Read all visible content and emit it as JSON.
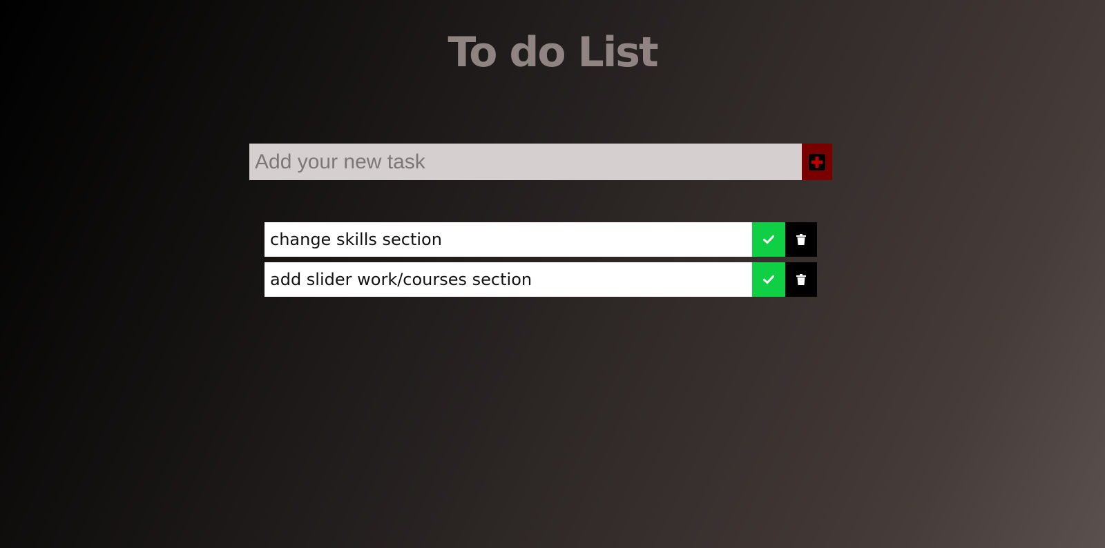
{
  "app": {
    "title": "To do List"
  },
  "new_task": {
    "placeholder": "Add your new task",
    "value": "",
    "add_icon": "plus-square-icon"
  },
  "tasks": [
    {
      "text": "change skills section",
      "complete_icon": "check-icon",
      "delete_icon": "trash-icon"
    },
    {
      "text": "add slider work/courses section",
      "complete_icon": "check-icon",
      "delete_icon": "trash-icon"
    }
  ],
  "colors": {
    "add_button": "#7a0000",
    "add_icon_fill": "#000000",
    "add_icon_cross": "#c00000",
    "complete_button": "#0fd044",
    "delete_button": "#000000",
    "input_background": "#d5cfcf",
    "title": "#8f8482"
  }
}
